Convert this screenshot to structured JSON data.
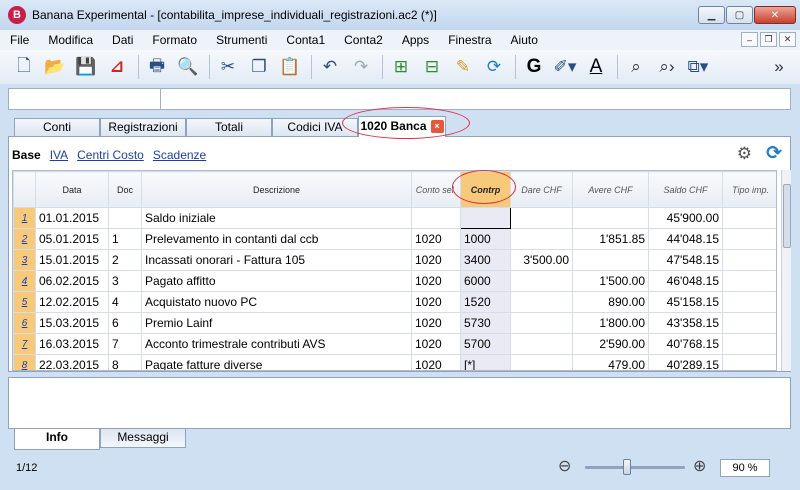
{
  "window": {
    "title": "Banana Experimental - [contabilita_imprese_individuali_registrazioni.ac2 (*)]",
    "app_icon": "B"
  },
  "menu": [
    "File",
    "Modifica",
    "Dati",
    "Formato",
    "Strumenti",
    "Conta1",
    "Conta2",
    "Apps",
    "Finestra",
    "Aiuto"
  ],
  "toolbar": {
    "icons": [
      "new-file-icon",
      "open-icon",
      "save-icon",
      "pdf-icon",
      "print-icon",
      "preview-icon",
      "cut-icon",
      "copy-icon",
      "paste-icon",
      "undo-icon",
      "redo-icon",
      "add-row-icon",
      "delete-row-icon",
      "edit-icon",
      "recheck-icon",
      "bold-icon",
      "highlight-icon",
      "font-color-icon",
      "find-icon",
      "find-next-icon",
      "window-icon"
    ],
    "bold_label": "G",
    "font_color_label": "A"
  },
  "tabs": [
    {
      "label": "Conti"
    },
    {
      "label": "Registrazioni"
    },
    {
      "label": "Totali"
    },
    {
      "label": "Codici IVA"
    },
    {
      "label": "1020 Banca",
      "active": true
    }
  ],
  "tab_close_glyph": "×",
  "subtabs": [
    {
      "label": "Base",
      "active": true
    },
    {
      "label": "IVA"
    },
    {
      "label": "Centri Costo"
    },
    {
      "label": "Scadenze"
    }
  ],
  "table": {
    "headers": [
      "Data",
      "Doc",
      "Descrizione",
      "Conto sel.",
      "Contrp",
      "Dare CHF",
      "Avere CHF",
      "Saldo CHF",
      "Tipo imp."
    ],
    "rows": [
      {
        "n": "1",
        "date": "01.01.2015",
        "doc": "",
        "desc": "Saldo iniziale",
        "conto": "",
        "contrp": "",
        "dare": "",
        "avere": "",
        "saldo": "45'900.00",
        "tipo": ""
      },
      {
        "n": "2",
        "date": "05.01.2015",
        "doc": "1",
        "desc": "Prelevamento in contanti dal ccb",
        "conto": "1020",
        "contrp": "1000",
        "dare": "",
        "avere": "1'851.85",
        "saldo": "44'048.15",
        "tipo": ""
      },
      {
        "n": "3",
        "date": "15.01.2015",
        "doc": "2",
        "desc": "Incassati onorari - Fattura 105",
        "conto": "1020",
        "contrp": "3400",
        "dare": "3'500.00",
        "avere": "",
        "saldo": "47'548.15",
        "tipo": ""
      },
      {
        "n": "4",
        "date": "06.02.2015",
        "doc": "3",
        "desc": "Pagato affitto",
        "conto": "1020",
        "contrp": "6000",
        "dare": "",
        "avere": "1'500.00",
        "saldo": "46'048.15",
        "tipo": ""
      },
      {
        "n": "5",
        "date": "12.02.2015",
        "doc": "4",
        "desc": "Acquistato nuovo PC",
        "conto": "1020",
        "contrp": "1520",
        "dare": "",
        "avere": "890.00",
        "saldo": "45'158.15",
        "tipo": ""
      },
      {
        "n": "6",
        "date": "15.03.2015",
        "doc": "6",
        "desc": "Premio Lainf",
        "conto": "1020",
        "contrp": "5730",
        "dare": "",
        "avere": "1'800.00",
        "saldo": "43'358.15",
        "tipo": ""
      },
      {
        "n": "7",
        "date": "16.03.2015",
        "doc": "7",
        "desc": "Acconto trimestrale contributi AVS",
        "conto": "1020",
        "contrp": "5700",
        "dare": "",
        "avere": "2'590.00",
        "saldo": "40'768.15",
        "tipo": ""
      },
      {
        "n": "8",
        "date": "22.03.2015",
        "doc": "8",
        "desc": "Pagate fatture diverse",
        "conto": "1020",
        "contrp": "[*]",
        "dare": "",
        "avere": "479.00",
        "saldo": "40'289.15",
        "tipo": ""
      }
    ]
  },
  "bottom_tabs": [
    {
      "label": "Info",
      "active": true
    },
    {
      "label": "Messaggi"
    }
  ],
  "status": {
    "row_position": "1/12",
    "zoom": "90 %",
    "zoom_level": 0.42
  },
  "colors": {
    "accent": "#f7c97b",
    "highlight_oval": "#e23040",
    "close_red": "#c7402c"
  }
}
